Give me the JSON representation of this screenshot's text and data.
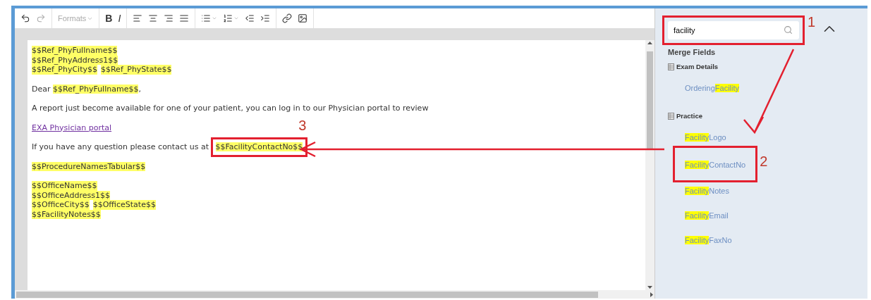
{
  "toolbar": {
    "formats": "Formats",
    "bold": "B",
    "italic": "I"
  },
  "document": {
    "paragraphs": [
      {
        "lines": [
          [
            {
              "kind": "field",
              "text": "$$Ref_PhyFullname$$"
            }
          ],
          [
            {
              "kind": "field",
              "text": "$$Ref_PhyAddress1$$"
            }
          ],
          [
            {
              "kind": "field",
              "text": "$$Ref_PhyCity$$"
            },
            {
              "kind": "field",
              "text": "$$Ref_PhyState$$"
            }
          ]
        ]
      },
      {
        "lines": [
          [
            {
              "kind": "text",
              "text": "Dear "
            },
            {
              "kind": "field",
              "text": "$$Ref_PhyFullname$$"
            },
            {
              "kind": "text",
              "text": ","
            }
          ]
        ]
      },
      {
        "lines": [
          [
            {
              "kind": "text",
              "text": "A report just become available for one of your patient, you can log in to our Physician portal to review"
            }
          ]
        ]
      },
      {
        "lines": [
          [
            {
              "kind": "link",
              "text": "EXA Physician portal"
            }
          ]
        ]
      },
      {
        "lines": [
          [
            {
              "kind": "text",
              "text": "If you have any question please contact us at "
            },
            {
              "kind": "field",
              "text": "$$FacilityContactNo$$",
              "callout": "3"
            }
          ]
        ]
      },
      {
        "lines": [
          [
            {
              "kind": "field",
              "text": "$$ProcedureNamesTabular$$"
            }
          ]
        ]
      },
      {
        "lines": [
          [
            {
              "kind": "field",
              "text": "$$OfficeName$$"
            }
          ],
          [
            {
              "kind": "field",
              "text": "$$OfficeAddress1$$"
            }
          ],
          [
            {
              "kind": "field",
              "text": "$$OfficeCity$$"
            },
            {
              "kind": "field",
              "text": "$$OfficeState$$"
            }
          ],
          [
            {
              "kind": "field",
              "text": "$$FacilityNotes$$"
            }
          ]
        ]
      }
    ]
  },
  "sidebar": {
    "search": {
      "value": "facility",
      "callout": "1"
    },
    "heading": "Merge Fields",
    "groups": [
      {
        "name": "Exam Details",
        "items": [
          {
            "parts": [
              {
                "text": "Ordering",
                "match": false
              },
              {
                "text": "Facility",
                "match": true
              }
            ]
          }
        ]
      },
      {
        "name": "Practice",
        "items": [
          {
            "parts": [
              {
                "text": "Facility",
                "match": true
              },
              {
                "text": "Logo",
                "match": false
              }
            ]
          },
          {
            "parts": [
              {
                "text": "Facility",
                "match": true
              },
              {
                "text": "ContactNo",
                "match": false
              }
            ],
            "callout": "2"
          },
          {
            "parts": [
              {
                "text": "Facility",
                "match": true
              },
              {
                "text": "Notes",
                "match": false
              }
            ]
          },
          {
            "parts": [
              {
                "text": "Facility",
                "match": true
              },
              {
                "text": "Email",
                "match": false
              }
            ]
          },
          {
            "parts": [
              {
                "text": "Facility",
                "match": true
              },
              {
                "text": "FaxNo",
                "match": false
              }
            ]
          }
        ]
      }
    ]
  }
}
